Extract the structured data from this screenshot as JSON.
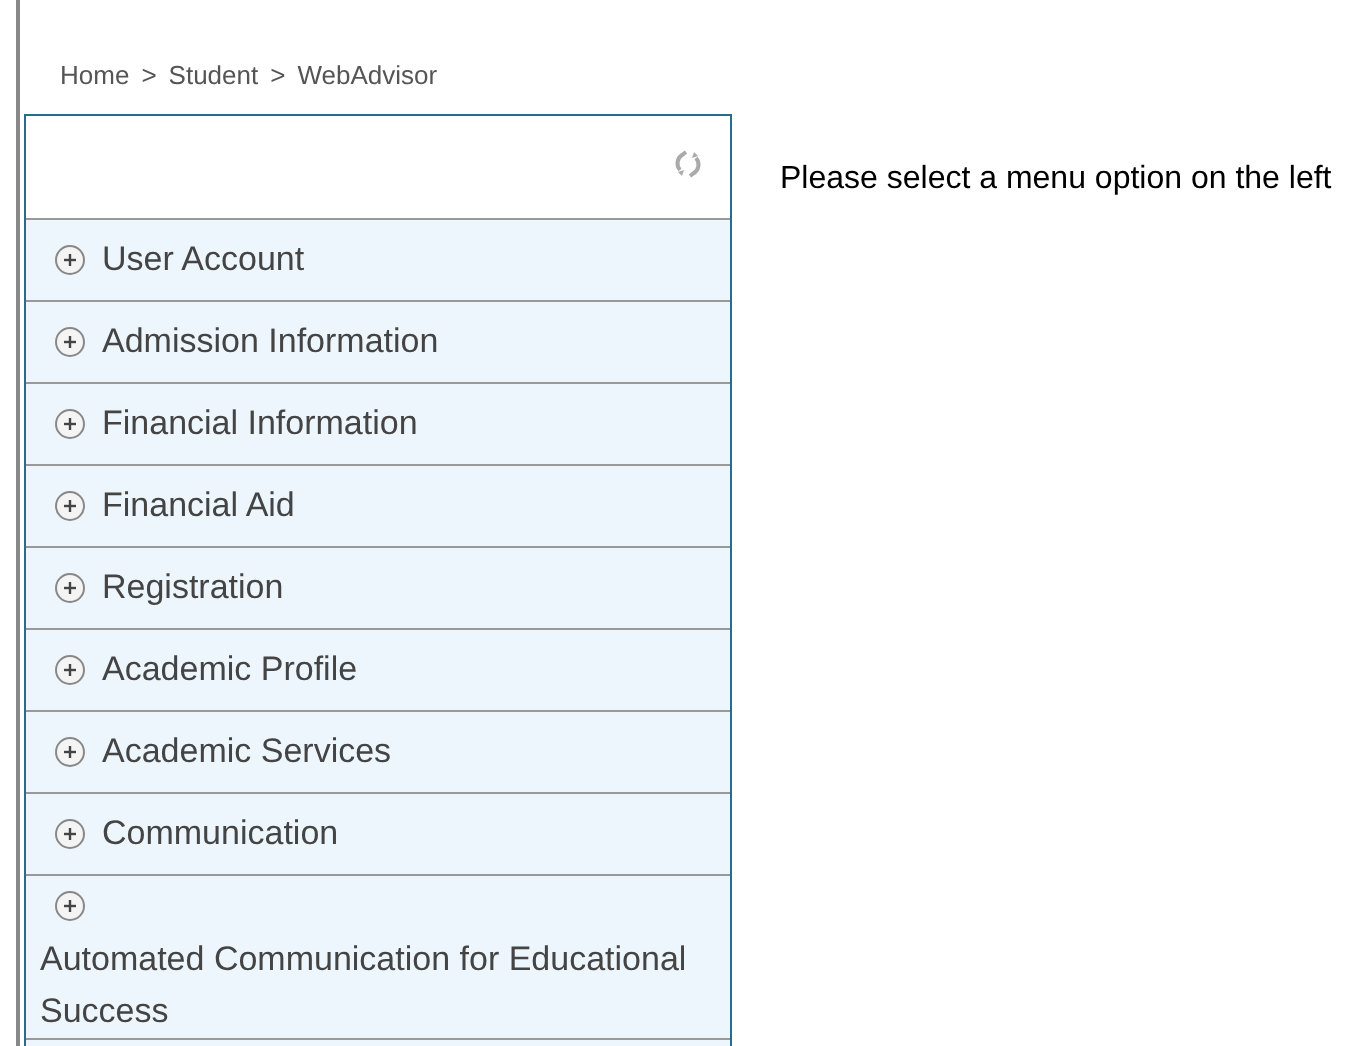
{
  "breadcrumb": [
    "Home",
    ">",
    "Student",
    ">",
    "WebAdvisor"
  ],
  "menu": {
    "items": [
      {
        "label": "User Account",
        "expanded": false,
        "kind": "inline"
      },
      {
        "label": "Admission Information",
        "expanded": false,
        "kind": "inline"
      },
      {
        "label": "Financial Information",
        "expanded": false,
        "kind": "inline"
      },
      {
        "label": "Financial Aid",
        "expanded": false,
        "kind": "inline"
      },
      {
        "label": "Registration",
        "expanded": false,
        "kind": "inline"
      },
      {
        "label": "Academic Profile",
        "expanded": false,
        "kind": "inline"
      },
      {
        "label": "Academic Services",
        "expanded": false,
        "kind": "inline"
      },
      {
        "label": "Communication",
        "expanded": false,
        "kind": "inline"
      },
      {
        "label": "Automated Communication for Educational Success",
        "expanded": false,
        "kind": "stacked"
      }
    ]
  },
  "message": "Please select a menu option on the left"
}
